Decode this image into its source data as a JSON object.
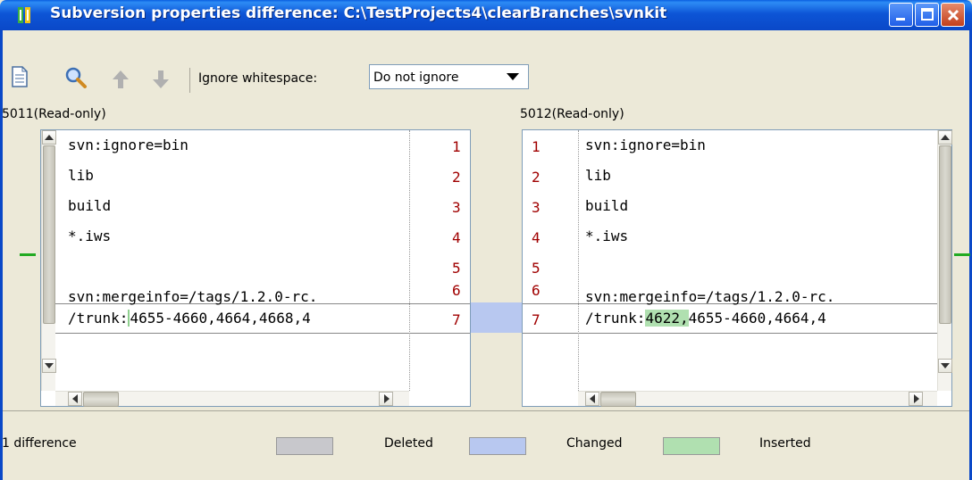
{
  "window": {
    "title": "Subversion properties difference: C:\\TestProjects4\\clearBranches\\svnkit",
    "buttons": [
      "minimize",
      "maximize",
      "close"
    ]
  },
  "toolbar": {
    "icons": [
      "document-icon",
      "search-icon",
      "arrow-up-icon",
      "arrow-down-icon"
    ],
    "whitespace_label": "Ignore whitespace:",
    "whitespace_value": "Do not ignore"
  },
  "left_pane": {
    "header": "5011(Read-only)",
    "lines": [
      {
        "num": "1",
        "text": "svn:ignore=bin"
      },
      {
        "num": "2",
        "text": "lib"
      },
      {
        "num": "3",
        "text": "build"
      },
      {
        "num": "4",
        "text": "*.iws"
      },
      {
        "num": "5",
        "text": ""
      },
      {
        "num": "6",
        "text": "svn:mergeinfo=/tags/1.2.0-rc."
      },
      {
        "num": "7",
        "prefix": "/trunk:",
        "text": "4655-4660,4664,4668,4"
      }
    ]
  },
  "right_pane": {
    "header": "5012(Read-only)",
    "lines": [
      {
        "num": "1",
        "text": "svn:ignore=bin"
      },
      {
        "num": "2",
        "text": "lib"
      },
      {
        "num": "3",
        "text": "build"
      },
      {
        "num": "4",
        "text": "*.iws"
      },
      {
        "num": "5",
        "text": ""
      },
      {
        "num": "6",
        "text": "svn:mergeinfo=/tags/1.2.0-rc."
      },
      {
        "num": "7",
        "prefix": "/trunk:",
        "inserted": "4622,",
        "text": "4655-4660,4664,4"
      }
    ]
  },
  "status": {
    "count": "1 difference",
    "legend": [
      {
        "label": "Deleted",
        "color": "#c8c8cc"
      },
      {
        "label": "Changed",
        "color": "#b8c8f0"
      },
      {
        "label": "Inserted",
        "color": "#b0e0b0"
      }
    ]
  },
  "colors": {
    "titlebar": "#0a48c8",
    "changed_row": "#b8c8f0",
    "inserted_text": "#b0e0b0",
    "line_number": "#a00000"
  }
}
